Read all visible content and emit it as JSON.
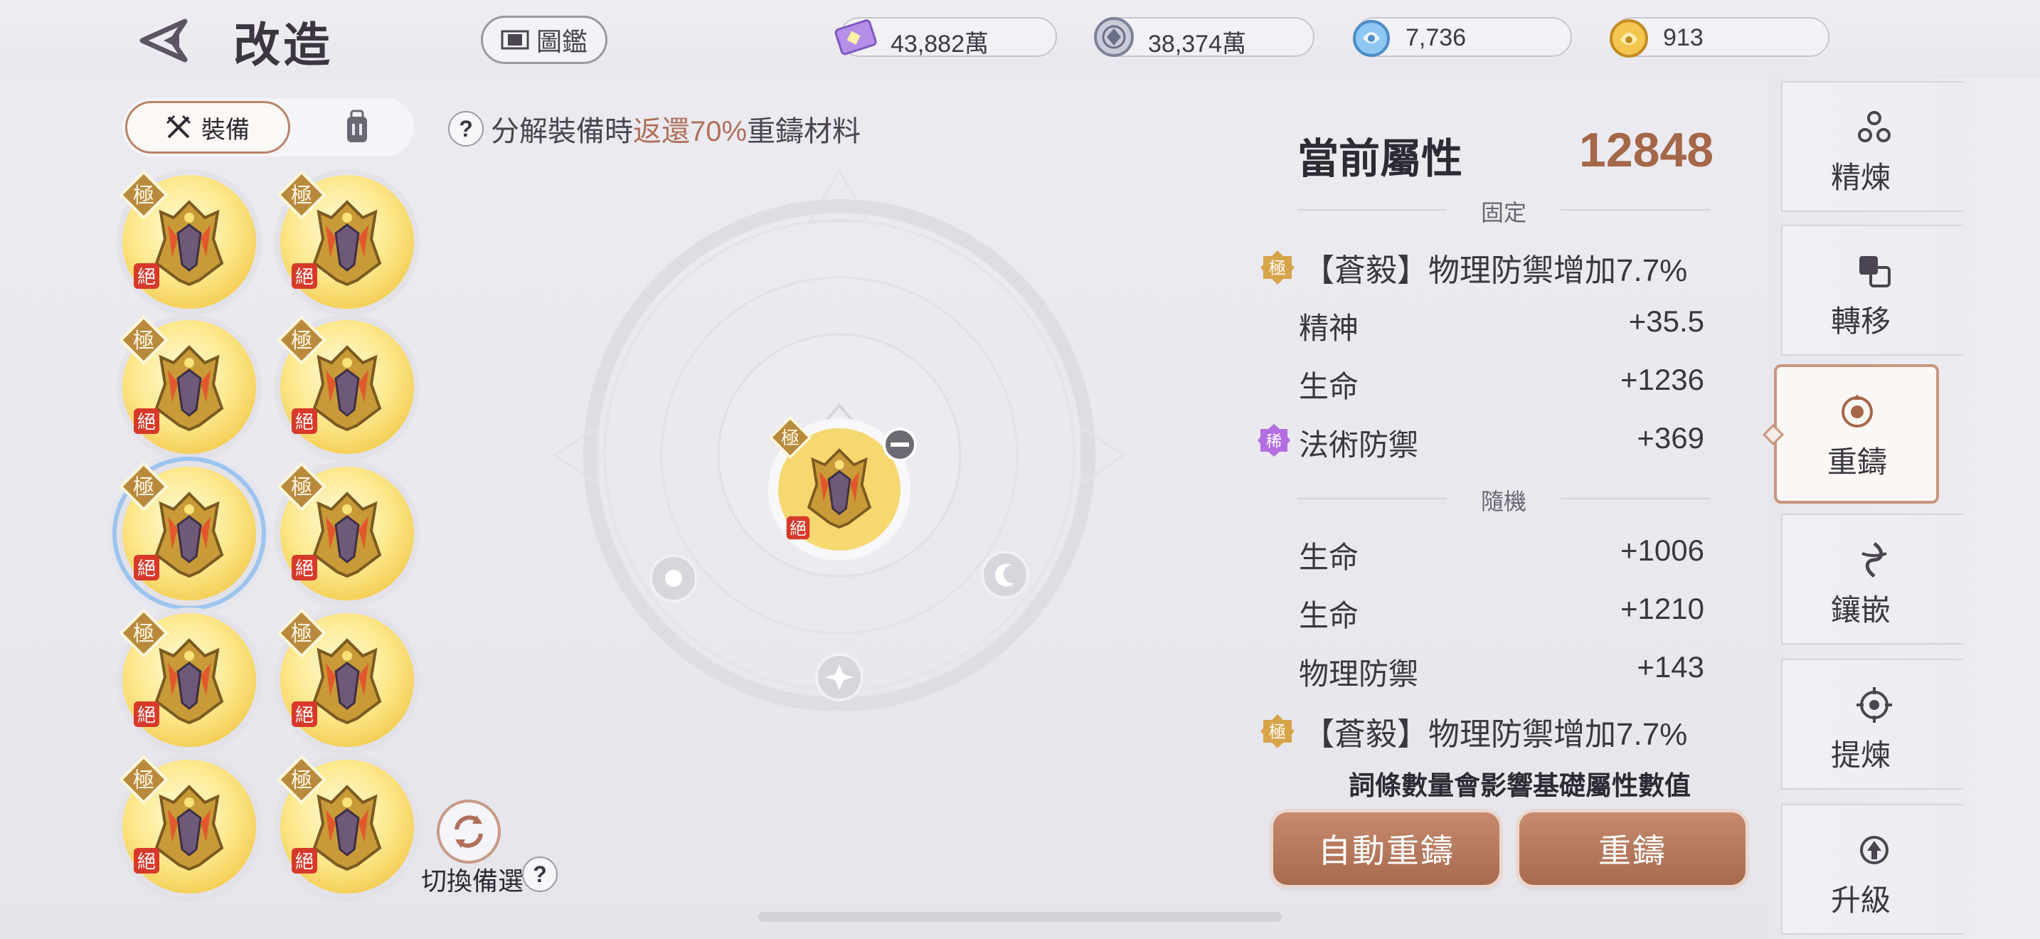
{
  "header": {
    "title": "改造",
    "guide_label": "圖鑑"
  },
  "currencies": [
    {
      "icon": "purple-ticket-icon",
      "value": "43,882萬"
    },
    {
      "icon": "silver-coin-icon",
      "value": "38,374萬"
    },
    {
      "icon": "blue-spirit-icon",
      "value": "7,736"
    },
    {
      "icon": "gold-coin-icon",
      "value": "913"
    }
  ],
  "tabs": {
    "equip_label": "裝備"
  },
  "hint": {
    "prefix": "分解裝備時",
    "highlight": "返還70%",
    "suffix": "重鑄材料"
  },
  "badges": {
    "ji": "極",
    "jue": "絕",
    "xi": "稀"
  },
  "switch": {
    "label": "切換備選"
  },
  "panel": {
    "title": "當前屬性",
    "power": "12848",
    "fixed_label": "固定",
    "random_label": "隨機",
    "fixed_special": "【蒼毅】物理防禦增加7.7%",
    "fixed_stats": [
      {
        "name": "精神",
        "value": "+35.5"
      },
      {
        "name": "生命",
        "value": "+1236"
      },
      {
        "name": "法術防禦",
        "value": "+369"
      }
    ],
    "random_stats": [
      {
        "name": "生命",
        "value": "+1006"
      },
      {
        "name": "生命",
        "value": "+1210"
      },
      {
        "name": "物理防禦",
        "value": "+143"
      }
    ],
    "random_special": "【蒼毅】物理防禦增加7.7%",
    "note": "詞條數量會影響基礎屬性數值",
    "auto_button": "自動重鑄",
    "reforge_button": "重鑄"
  },
  "sidenav": [
    {
      "label": "精煉",
      "icon": "refine-icon"
    },
    {
      "label": "轉移",
      "icon": "transfer-icon"
    },
    {
      "label": "重鑄",
      "icon": "reforge-icon"
    },
    {
      "label": "鑲嵌",
      "icon": "inlay-icon"
    },
    {
      "label": "提煉",
      "icon": "extract-icon"
    },
    {
      "label": "升級",
      "icon": "upgrade-icon"
    }
  ]
}
